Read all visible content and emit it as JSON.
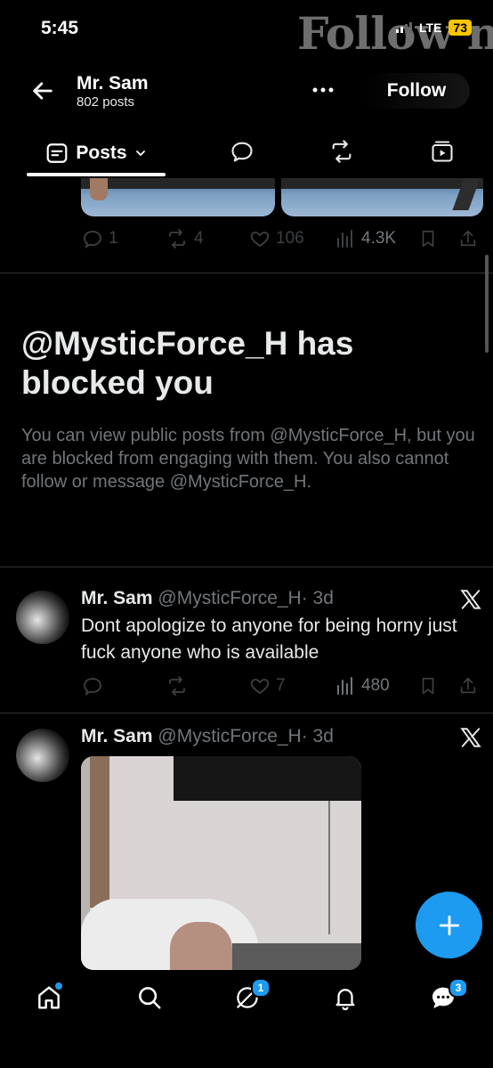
{
  "status_bar": {
    "time": "5:45",
    "network": "LTE",
    "battery": "73"
  },
  "watermark": "Follow n",
  "header": {
    "name": "Mr. Sam",
    "post_count": "802 posts",
    "follow_label": "Follow"
  },
  "tabs": {
    "posts_label": "Posts"
  },
  "top_post": {
    "replies": "1",
    "reposts": "4",
    "likes": "106",
    "views": "4.3K"
  },
  "blocked": {
    "title": "@MysticForce_H has blocked you",
    "description": "You can view public posts from @MysticForce_H, but you are blocked from engaging with them. You also cannot follow or message @MysticForce_H."
  },
  "tweets": [
    {
      "name": "Mr. Sam",
      "handle": "@MysticForce_H",
      "time": "· 3d",
      "text": "Dont apologize to anyone for being horny just fuck anyone who is available",
      "likes": "7",
      "views": "480"
    },
    {
      "name": "Mr. Sam",
      "handle": "@MysticForce_H",
      "time": "· 3d"
    }
  ],
  "nav": {
    "chat_badge": "1",
    "messages_badge": "3"
  },
  "colors": {
    "accent": "#1d9bf0",
    "background": "#000000",
    "muted": "#71767b",
    "battery": "#f7c600"
  }
}
